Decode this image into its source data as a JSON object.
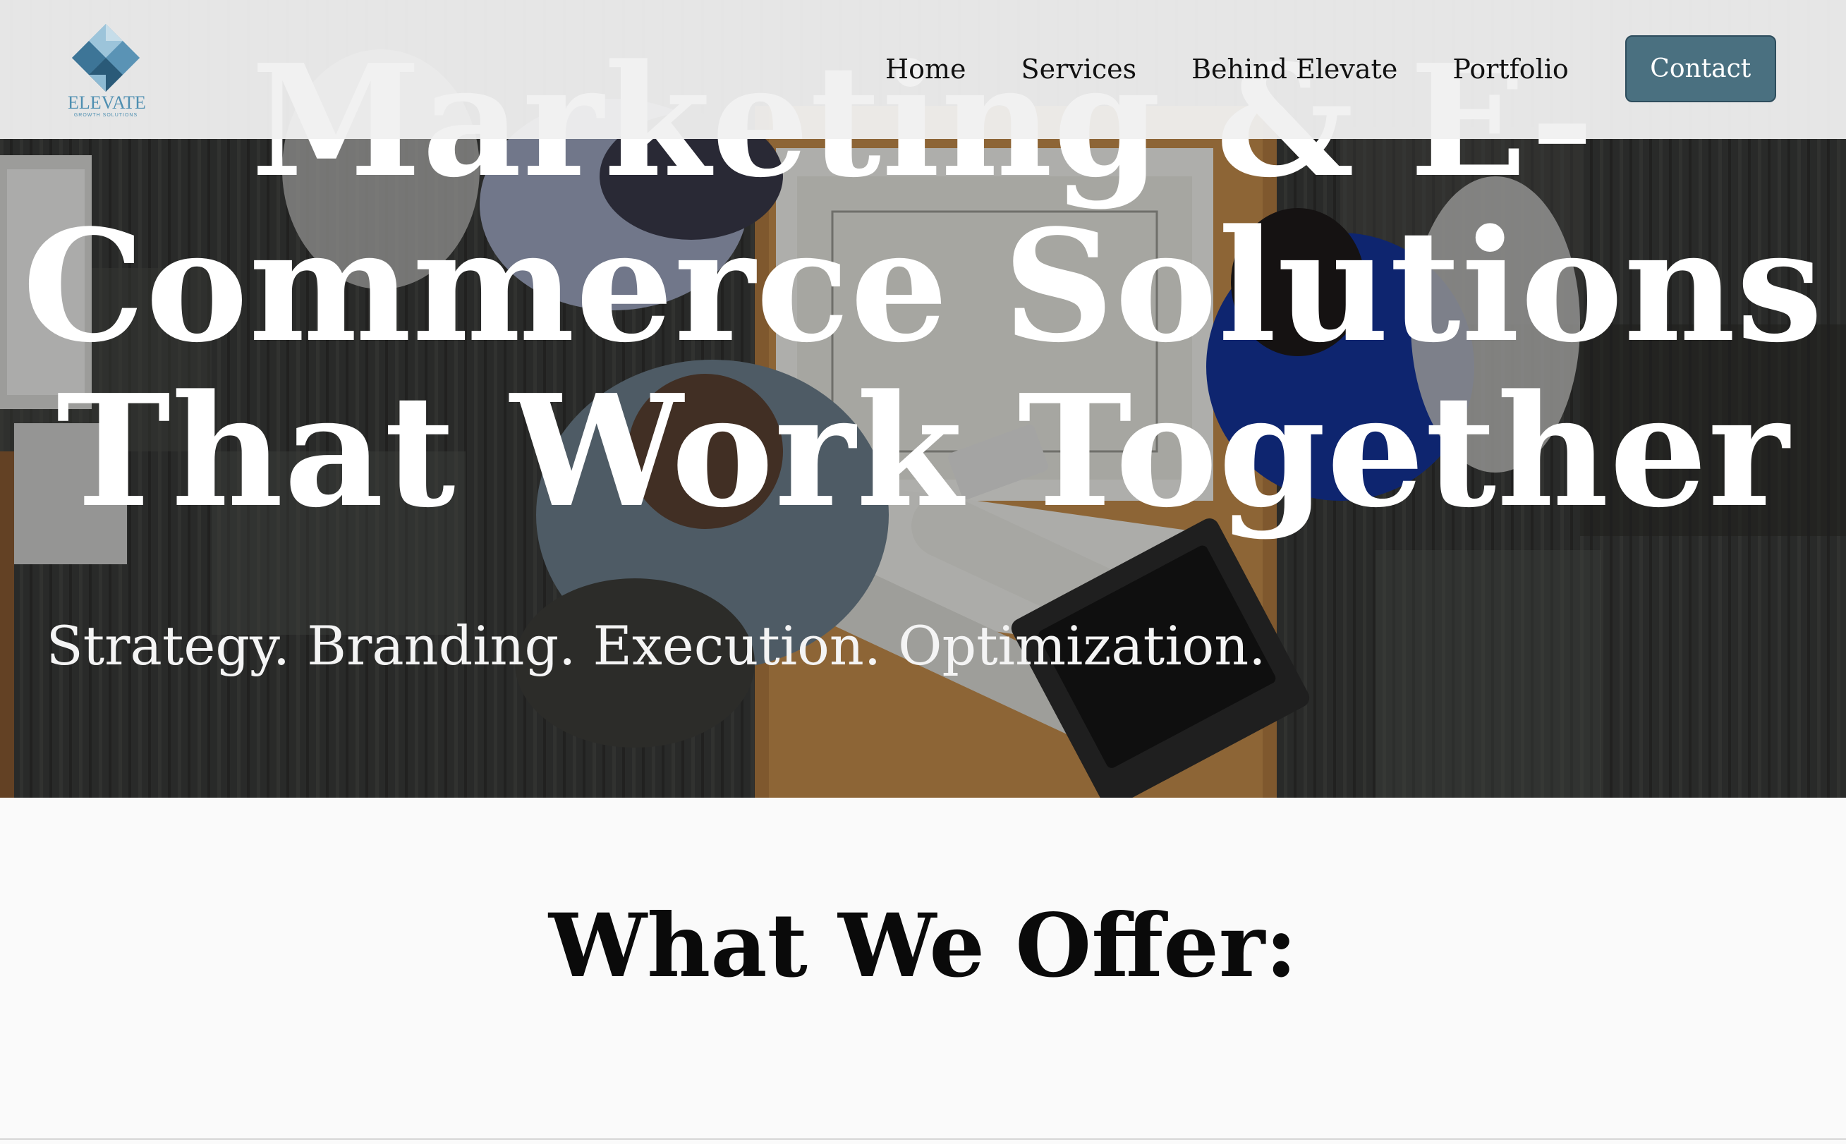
{
  "header": {
    "logo": {
      "name": "ELEVATE",
      "subtitle": "GROWTH SOLUTIONS",
      "icon": "elevate-diamond-logo"
    },
    "nav": [
      {
        "label": "Home"
      },
      {
        "label": "Services"
      },
      {
        "label": "Behind Elevate"
      },
      {
        "label": "Portfolio"
      }
    ],
    "contact_label": "Contact",
    "colors": {
      "contact_button": "#4a7080",
      "logo_blue": "#4f8fb1"
    }
  },
  "hero": {
    "headline_lines": [
      "Marketing & E-",
      "Commerce Solutions",
      "That Work Together"
    ],
    "tagline": "Strategy. Branding. Execution. Optimization."
  },
  "offer": {
    "title": "What We Offer:"
  }
}
